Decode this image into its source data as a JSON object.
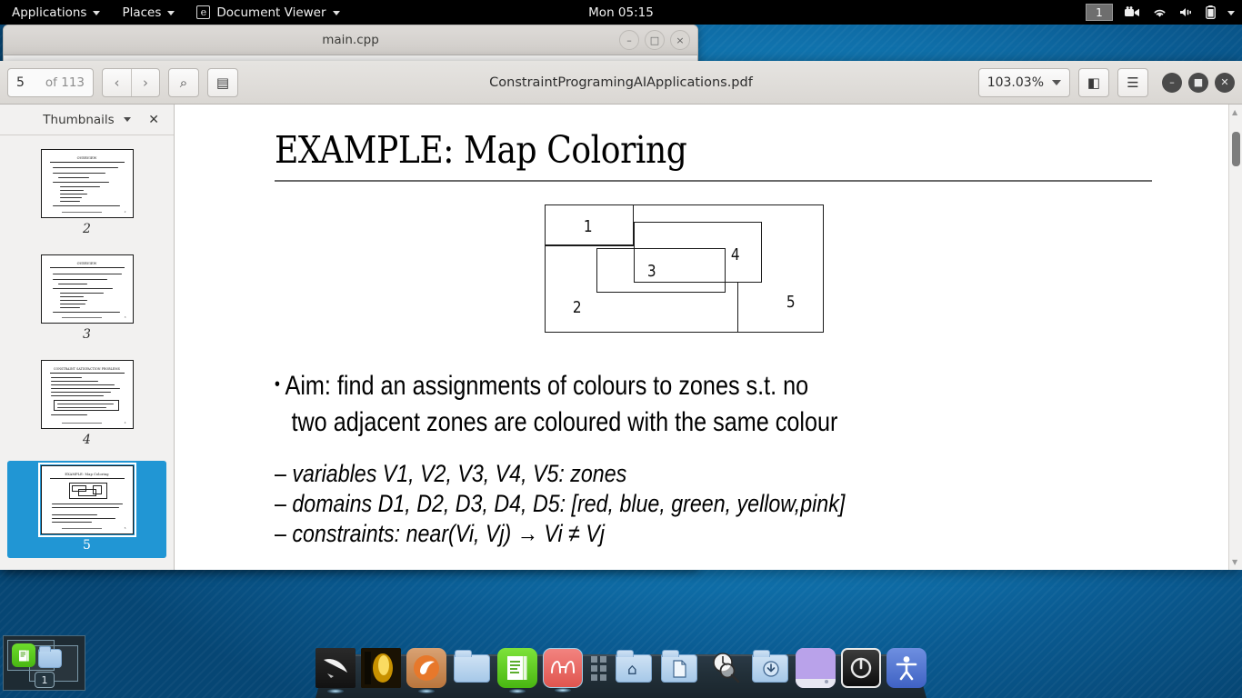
{
  "top_panel": {
    "applications_label": "Applications",
    "places_label": "Places",
    "app_menu_label": "Document Viewer",
    "clock": "Mon 05:15",
    "workspace": "1",
    "tray_icons": [
      "video-camera-icon",
      "wifi-icon",
      "volume-icon",
      "battery-icon",
      "chevron-down-icon"
    ]
  },
  "background_window": {
    "title": "main.cpp",
    "minimize": "–",
    "maximize": "□",
    "close": "×"
  },
  "viewer": {
    "title": "ConstraintProgramingAIApplications.pdf",
    "page_current": "5",
    "page_total": "of 113",
    "prev_label": "‹",
    "next_label": "›",
    "search_label": "⌕",
    "annotations_label": "▤",
    "zoom_level": "103.03%",
    "fit_page_label": "◧",
    "menu_label": "☰",
    "window_minimize": "–",
    "window_maximize": "■",
    "window_close": "✕"
  },
  "sidebar": {
    "header_label": "Thumbnails",
    "close_label": "✕",
    "thumbnails": [
      {
        "number": "2",
        "selected": false,
        "title": "OVERVIEW",
        "lines": [
          "Constraint Satisfaction/Optimization Problems",
          "Constraint (Logic) Programming",
          "languages/tools",
          "AI applications: modelling and solving",
          "Scheduling, Timetabling, Resource allocation",
          "Routing",
          "Planning / Cutting",
          "Simulation of tasks",
          "Routing",
          "Advantages and Limitations of CP extensions"
        ]
      },
      {
        "number": "3",
        "selected": false,
        "title": "OVERVIEW",
        "lines": [
          "Constraint Satisfaction (Optimization) Problems",
          "Constraint (Logic) Programming",
          "language: definitions",
          "AI applications: modelling and solving",
          "Scheduling / Timetabling, Resource allocation",
          "Routing",
          "Packing / Cutting",
          "Design / Mesh",
          "Planning",
          "Advantages and Limitations of CP extensions"
        ]
      },
      {
        "number": "4",
        "selected": false,
        "title": "CONSTRAINT SATISFACTION PROBLEMS",
        "lines": [
          "a CSP consists of:",
          "a set of variables (X1, X2, ..., Xn)",
          "for each variable Xi a domain Di of possible values",
          "a set of constraints on the variables; constraints are specified",
          "which constrain the values of the variables can take at the same time"
        ]
      },
      {
        "number": "5",
        "selected": true,
        "title": "EXAMPLE: Map Coloring",
        "lines": [
          "Aim: find an assignments of colours to zones s.t.",
          "two adjacent zones are coloured with the same colour",
          "variables V1, V2, V3, V4, V5: zones",
          "domains D1, D2, D3, D4, D5: [red, blue, green, yellow,pink]",
          "constraints: near(Vi,Vj) -> Vi != Vj"
        ]
      }
    ]
  },
  "slide": {
    "title": "EXAMPLE: Map Coloring",
    "map": {
      "caption": "map-coloring-diagram",
      "zone_labels": [
        "1",
        "2",
        "3",
        "4",
        "5"
      ]
    },
    "bullets": [
      {
        "marker": "•",
        "line1": "Aim: find an assignments of colours to zones s.t. no",
        "line2": "two adjacent zones are coloured with the same colour"
      }
    ],
    "sub_items": [
      {
        "dash": "–",
        "text": "variables V1, V2, V3, V4, V5: zones"
      },
      {
        "dash": "–",
        "text": "domains D1, D2, D3, D4, D5:  [red, blue, green, yellow,pink]"
      },
      {
        "dash": "–",
        "text": "constraints: near(Vi, Vj) → Vi ≠ Vj"
      }
    ]
  },
  "dock": {
    "items": [
      {
        "name": "kali-menu-icon",
        "glyph": "❯",
        "running": true
      },
      {
        "name": "terminal-icon",
        "glyph": "⌨",
        "running": true
      },
      {
        "name": "firefox-icon",
        "glyph": "◐",
        "running": true
      },
      {
        "name": "files-folder-icon",
        "glyph": "",
        "running": false
      },
      {
        "name": "text-editor-icon",
        "glyph": "☰",
        "running": true
      },
      {
        "name": "burpsuite-glasses-icon",
        "glyph": "๏",
        "running": false
      },
      {
        "name": "dock-separator",
        "glyph": "",
        "running": false
      },
      {
        "name": "home-folder-icon",
        "glyph": "⌂",
        "running": false
      },
      {
        "name": "documents-folder-icon",
        "glyph": "▤",
        "running": false
      },
      {
        "name": "search-clock-icon",
        "glyph": "⏱",
        "running": false
      },
      {
        "name": "downloads-folder-icon",
        "glyph": "↓",
        "running": false
      },
      {
        "name": "pictures-icon",
        "glyph": "",
        "running": false
      },
      {
        "name": "power-icon",
        "glyph": "⏻",
        "running": false
      },
      {
        "name": "accessibility-icon",
        "glyph": "໑",
        "running": false
      }
    ]
  },
  "pager": {
    "badge": "1"
  },
  "colors": {
    "accent_blue": "#2196d4",
    "panel_black": "#000000",
    "desktop_blue": "#1e8fc9",
    "chrome_gray": "#e6e4e1"
  }
}
